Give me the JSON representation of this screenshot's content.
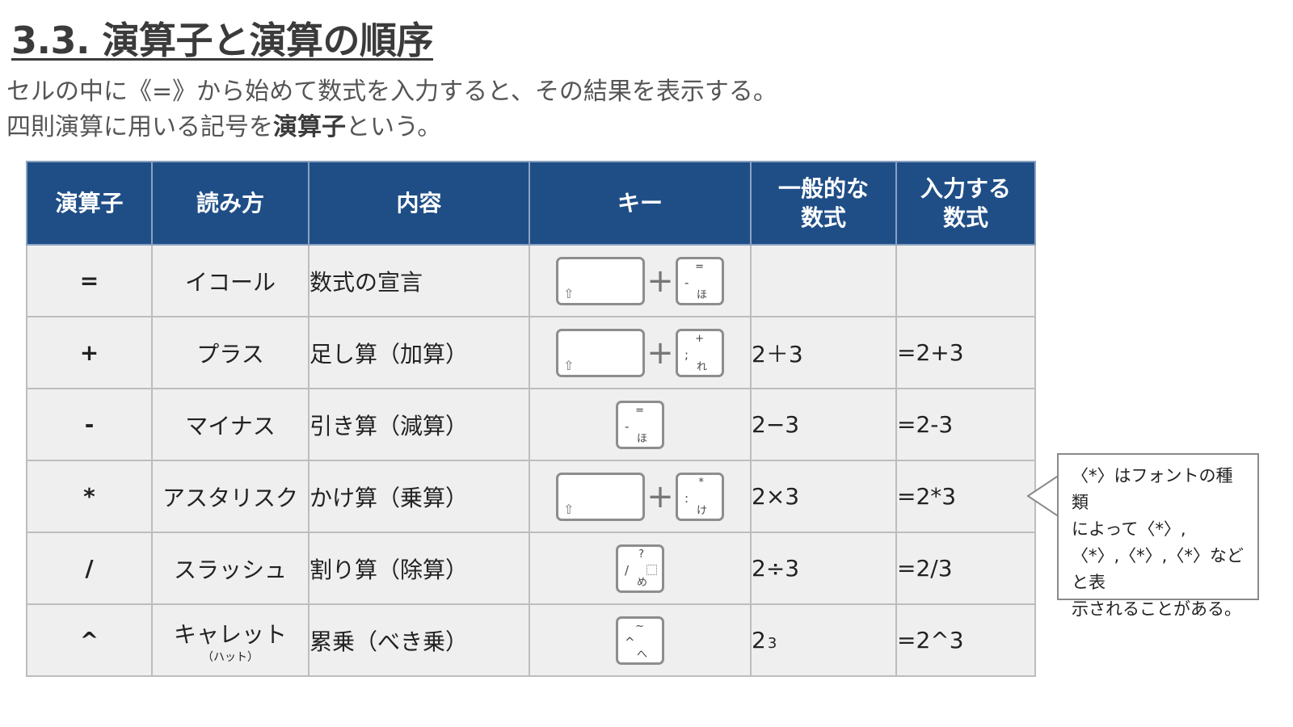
{
  "title": "3.3. 演算子と演算の順序",
  "intro": {
    "line1": "セルの中に《=》から始めて数式を入力すると、その結果を表示する。",
    "line2_prefix": "四則演算に用いる記号を",
    "line2_bold": "演算子",
    "line2_suffix": "という。"
  },
  "table": {
    "headers": [
      "演算子",
      "読み方",
      "内容",
      "キー",
      "一般的な\n数式",
      "入力する\n数式"
    ],
    "rows": [
      {
        "symbol": "=",
        "reading": "イコール",
        "reading_sub": "",
        "content": "数式の宣言",
        "formula": "",
        "formula_sup": "",
        "input": "",
        "key": {
          "shift": true,
          "top": "=",
          "left": "-",
          "bottom": "ほ",
          "box": false
        }
      },
      {
        "symbol": "+",
        "reading": "プラス",
        "reading_sub": "",
        "content": "足し算（加算）",
        "formula": "2＋3",
        "formula_sup": "",
        "input": "=2+3",
        "key": {
          "shift": true,
          "top": "+",
          "left": ";",
          "bottom": "れ",
          "box": false
        }
      },
      {
        "symbol": "-",
        "reading": "マイナス",
        "reading_sub": "",
        "content": "引き算（減算）",
        "formula": "2−3",
        "formula_sup": "",
        "input": "=2-3",
        "key": {
          "shift": false,
          "top": "=",
          "left": "-",
          "bottom": "ほ",
          "box": false
        }
      },
      {
        "symbol": "*",
        "reading": "アスタリスク",
        "reading_sub": "",
        "content": "かけ算（乗算）",
        "formula": "2×3",
        "formula_sup": "",
        "input": "=2*3",
        "key": {
          "shift": true,
          "top": "*",
          "left": ":",
          "bottom": "け",
          "box": false
        }
      },
      {
        "symbol": "/",
        "reading": "スラッシュ",
        "reading_sub": "",
        "content": "割り算（除算）",
        "formula": "2÷3",
        "formula_sup": "",
        "input": "=2/3",
        "key": {
          "shift": false,
          "top": "?",
          "left": "/",
          "bottom": "め",
          "box": true
        }
      },
      {
        "symbol": "^",
        "reading": "キャレット",
        "reading_sub": "（ハット）",
        "content": "累乗（べき乗）",
        "formula": "2",
        "formula_sup": "3",
        "input": "=2^3",
        "key": {
          "shift": false,
          "top": "~",
          "left": "^",
          "bottom": "へ",
          "box": false
        }
      }
    ]
  },
  "note": "〈*〉はフォントの種類\nによって〈*〉,\n〈*〉,〈*〉,〈*〉などと表\n示されることがある。",
  "icons": {
    "shift": "shift-key-icon",
    "plus": "plus-icon"
  },
  "colors": {
    "header_bg": "#1f4e87",
    "cell_bg": "#efefef",
    "title": "#3b3b3b"
  }
}
